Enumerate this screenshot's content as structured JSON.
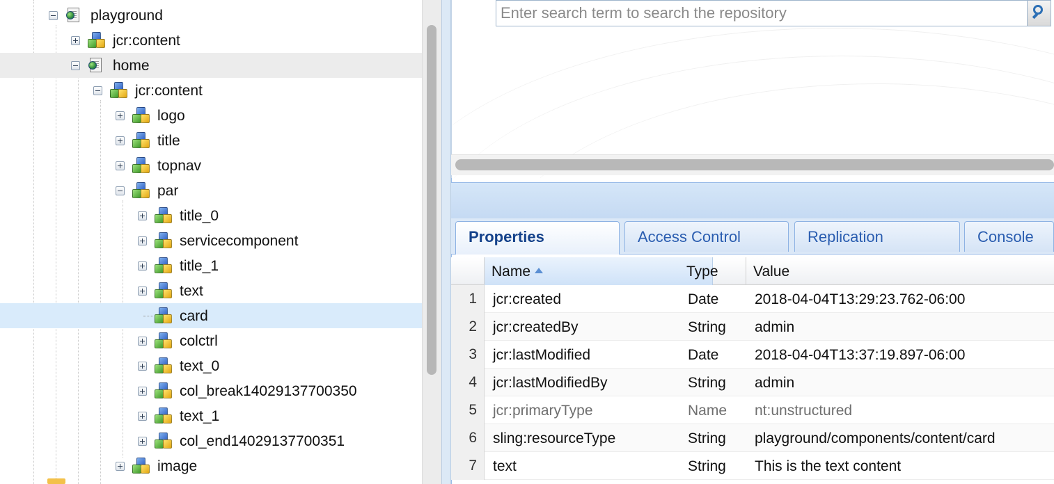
{
  "tree": {
    "nodes": [
      {
        "label": "playground",
        "icon": "page-globe-icon",
        "toggle": "minus"
      },
      {
        "label": "jcr:content",
        "icon": "node-cubes-icon",
        "toggle": "plus"
      },
      {
        "label": "home",
        "icon": "page-globe-icon",
        "toggle": "minus"
      },
      {
        "label": "jcr:content",
        "icon": "node-cubes-icon",
        "toggle": "minus"
      },
      {
        "label": "logo",
        "icon": "node-cubes-icon",
        "toggle": "plus"
      },
      {
        "label": "title",
        "icon": "node-cubes-icon",
        "toggle": "plus"
      },
      {
        "label": "topnav",
        "icon": "node-cubes-icon",
        "toggle": "plus"
      },
      {
        "label": "par",
        "icon": "node-cubes-icon",
        "toggle": "minus"
      },
      {
        "label": "title_0",
        "icon": "node-cubes-icon",
        "toggle": "plus"
      },
      {
        "label": "servicecomponent",
        "icon": "node-cubes-icon",
        "toggle": "plus"
      },
      {
        "label": "title_1",
        "icon": "node-cubes-icon",
        "toggle": "plus"
      },
      {
        "label": "text",
        "icon": "node-cubes-icon",
        "toggle": "plus"
      },
      {
        "label": "card",
        "icon": "node-cubes-icon",
        "toggle": "none"
      },
      {
        "label": "colctrl",
        "icon": "node-cubes-icon",
        "toggle": "plus"
      },
      {
        "label": "text_0",
        "icon": "node-cubes-icon",
        "toggle": "plus"
      },
      {
        "label": "col_break14029137700350",
        "icon": "node-cubes-icon",
        "toggle": "plus"
      },
      {
        "label": "text_1",
        "icon": "node-cubes-icon",
        "toggle": "plus"
      },
      {
        "label": "col_end14029137700351",
        "icon": "node-cubes-icon",
        "toggle": "plus"
      },
      {
        "label": "image",
        "icon": "node-cubes-icon",
        "toggle": "plus"
      }
    ]
  },
  "search": {
    "placeholder": "Enter search term to search the repository",
    "button_icon": "search-icon"
  },
  "tabs": [
    {
      "label": "Properties",
      "active": true
    },
    {
      "label": "Access Control",
      "active": false
    },
    {
      "label": "Replication",
      "active": false
    },
    {
      "label": "Console",
      "active": false
    }
  ],
  "grid": {
    "columns": {
      "name": "Name",
      "type": "Type",
      "value": "Value"
    },
    "rows": [
      {
        "num": "1",
        "name": "jcr:created",
        "type": "Date",
        "value": "2018-04-04T13:29:23.762-06:00"
      },
      {
        "num": "2",
        "name": "jcr:createdBy",
        "type": "String",
        "value": "admin"
      },
      {
        "num": "3",
        "name": "jcr:lastModified",
        "type": "Date",
        "value": "2018-04-04T13:37:19.897-06:00"
      },
      {
        "num": "4",
        "name": "jcr:lastModifiedBy",
        "type": "String",
        "value": "admin"
      },
      {
        "num": "5",
        "name": "jcr:primaryType",
        "type": "Name",
        "value": "nt:unstructured"
      },
      {
        "num": "6",
        "name": "sling:resourceType",
        "type": "String",
        "value": "playground/components/content/card"
      },
      {
        "num": "7",
        "name": "text",
        "type": "String",
        "value": "This is the text content"
      }
    ]
  },
  "colors": {
    "selected_row": "#d9ebfb",
    "hover_row": "#ececec",
    "tab_text": "#2a5db0",
    "active_tab_text": "#15428b"
  }
}
